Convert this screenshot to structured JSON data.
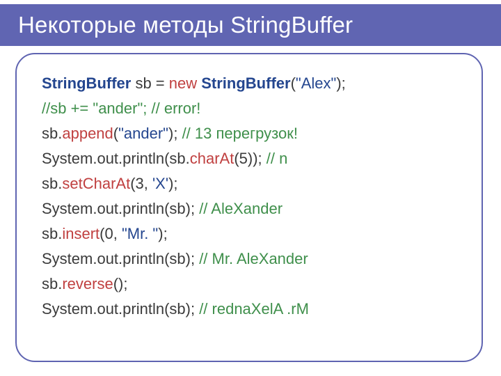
{
  "title": "Некоторые методы StringBuffer",
  "code": {
    "l1": {
      "a": "StringBuffer",
      "b": " sb = ",
      "c": "new",
      "d": " ",
      "e": "StringBuffer",
      "f": "(",
      "g": "\"Alex\"",
      "h": ");"
    },
    "l2": {
      "a": "//sb += \"ander\"; // error!"
    },
    "l3": {
      "a": "sb.",
      "b": "append",
      "c": "(",
      "d": "\"ander\"",
      "e": "); ",
      "f": "// 13 перегрузок!"
    },
    "l4": {
      "a": "System.out.println(sb.",
      "b": "charAt",
      "c": "(5)); ",
      "d": "// n"
    },
    "l5": {
      "a": "sb.",
      "b": "setCharAt",
      "c": "(3, ",
      "d": "'X'",
      "e": ");"
    },
    "l6": {
      "a": "System.out.println(sb); ",
      "b": "// AleXander"
    },
    "l7": {
      "a": "sb.",
      "b": "insert",
      "c": "(0, ",
      "d": "\"Mr. \"",
      "e": ");"
    },
    "l8": {
      "a": "System.out.println(sb); ",
      "b": "// Mr. AleXander"
    },
    "l9": {
      "a": "sb.",
      "b": "reverse",
      "c": "();"
    },
    "l10": {
      "a": "System.out.println(sb); ",
      "b": "// rednaXelA .rM"
    }
  }
}
